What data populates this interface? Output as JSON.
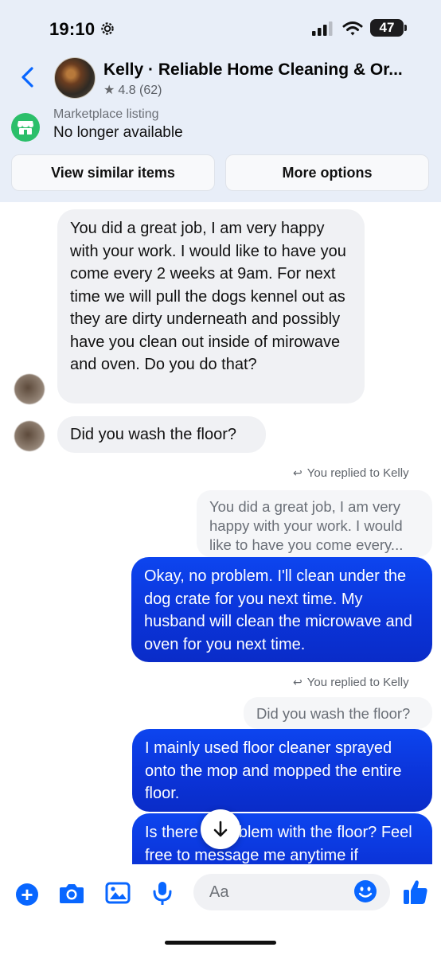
{
  "status": {
    "time": "19:10",
    "battery": "47"
  },
  "header": {
    "name": "Kelly · Reliable Home Cleaning & Or...",
    "rating": "4.8 (62)"
  },
  "listing": {
    "label": "Marketplace listing",
    "status": "No longer available",
    "buttons": [
      "View similar items",
      "More options"
    ]
  },
  "messages": {
    "in1": "You did a great job, I am very happy with your work. I would like to have you come every 2 weeks at 9am. For next time we will pull the dogs kennel out as they are dirty underneath and possibly have you clean out inside of mirowave and oven. Do you do that?",
    "in2": "Did you wash the floor?",
    "reply_note": "You replied to Kelly",
    "quote1": "You did a great job, I am very happy with your work. I would like to have you come every...",
    "out1": "Okay, no problem. I'll clean under the dog crate for you next time. My husband will clean the microwave and oven for you next time.",
    "quote2": "Did you wash the floor?",
    "out2": "I mainly used floor cleaner sprayed onto the mop and mopped the entire floor.",
    "out3": "Is there a problem with the floor? Feel free to message me anytime if"
  },
  "composer": {
    "placeholder": "Aa"
  },
  "colors": {
    "accent": "#0866ff",
    "bubble_out": "#0b34d9",
    "bubble_in": "#f0f1f4",
    "marketplace": "#2bbf6a"
  }
}
